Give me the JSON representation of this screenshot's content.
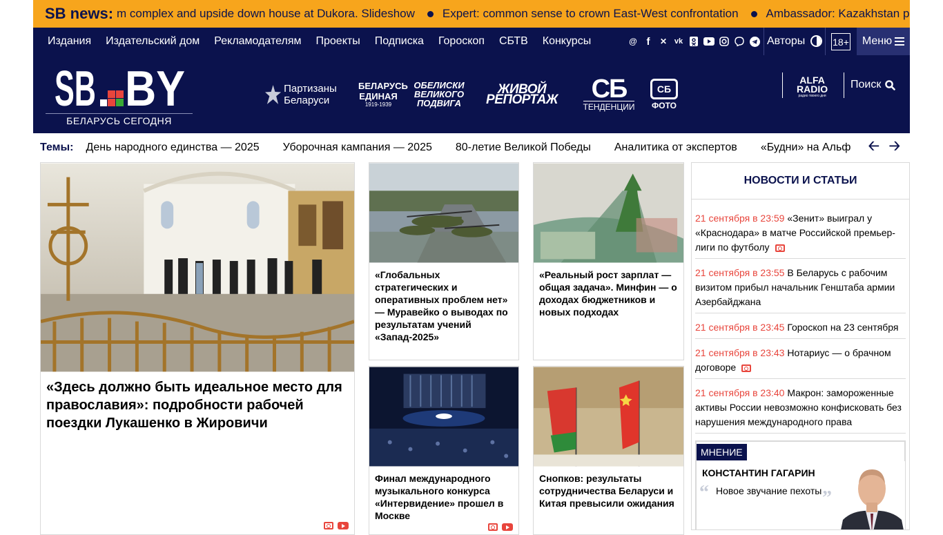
{
  "ticker": {
    "label": "SB news:",
    "items": [
      "m complex and upside down house at Dukora. Slideshow",
      "Expert: common sense to crown East-West confrontation",
      "Ambassador: Kazakhstan pro"
    ]
  },
  "nav": {
    "items": [
      "Издания",
      "Издательский дом",
      "Рекламодателям",
      "Проекты",
      "Подписка",
      "Гороскоп",
      "СБТВ",
      "Конкурсы"
    ],
    "socials": [
      "threads-icon",
      "facebook-icon",
      "x-icon",
      "vk-icon",
      "odnoklassniki-icon",
      "youtube-icon",
      "instagram-icon",
      "viber-icon",
      "telegram-icon"
    ],
    "authors": "Авторы",
    "age": "18+",
    "menu": "Меню"
  },
  "header": {
    "logo_text": "SB..BY",
    "logo_sub": "БЕЛАРУСЬ СЕГОДНЯ",
    "projects": {
      "partisans": "Партизаны Беларуси",
      "belarus_one": "БЕЛАРУСЬ ЕДИНАЯ",
      "belarus_one_years": "1919-1939",
      "obelisks": "ОБЕЛИСКИ ВЕЛИКОГО ПОДВИГА",
      "live_report": "ЖИВОЙ РЕПОРТАЖ",
      "trends_logo": "СБ",
      "trends": "ТЕНДЕНЦИИ",
      "photo_logo": "СБ",
      "photo": "ФОТО"
    },
    "radio_top": "ALFA",
    "radio_bottom": "RADIO",
    "radio_tagline": "радио твоего дня",
    "search": "Поиск"
  },
  "topics": {
    "label": "Темы:",
    "items": [
      "День народного единства — 2025",
      "Уборочная кампания — 2025",
      "80-летие Великой Победы",
      "Аналитика от экспертов",
      "«Будни» на Альф"
    ]
  },
  "main_story": {
    "title": "«Здесь должно быть идеальное место для православия»: подробности рабочей поездки Лукашенко в Жировичи"
  },
  "cards": [
    {
      "title": "«Глобальных стратегических и оперативных проблем нет» — Муравейко о выводах по результатам учений «Запад-2025»"
    },
    {
      "title": "«Реальный рост зарплат — общая задача». Минфин — о доходах бюджетников и новых подходах"
    },
    {
      "title": "Финал международного музыкального конкурса «Интервидение» прошел в Москве"
    },
    {
      "title": "Снопков: результаты сотрудничества Беларуси и Китая превысили ожидания"
    }
  ],
  "news": {
    "header": "НОВОСТИ И СТАТЬИ",
    "items": [
      {
        "time": "21 сентября в 23:59",
        "text": "«Зенит» выиграл у «Краснодара» в матче Российской премьер-лиги по футболу"
      },
      {
        "time": "21 сентября в 23:55",
        "text": "В Беларусь с рабочим визитом прибыл начальник Генштаба армии Азербайджана"
      },
      {
        "time": "21 сентября в 23:45",
        "text": "Гороскоп на 23 сентября"
      },
      {
        "time": "21 сентября в 23:43",
        "text": "Нотариус — о брачном договоре"
      },
      {
        "time": "21 сентября в 23:40",
        "text": "Макрон: замороженные активы России невозможно конфисковать без нарушения международного права"
      }
    ]
  },
  "opinion": {
    "badge": "МНЕНИЕ",
    "author": "КОНСТАНТИН ГАГАРИН",
    "quote": "Новое звучание пехоты"
  },
  "colors": {
    "navy": "#0b124d",
    "orange": "#f7a51c",
    "red": "#e8453c"
  }
}
